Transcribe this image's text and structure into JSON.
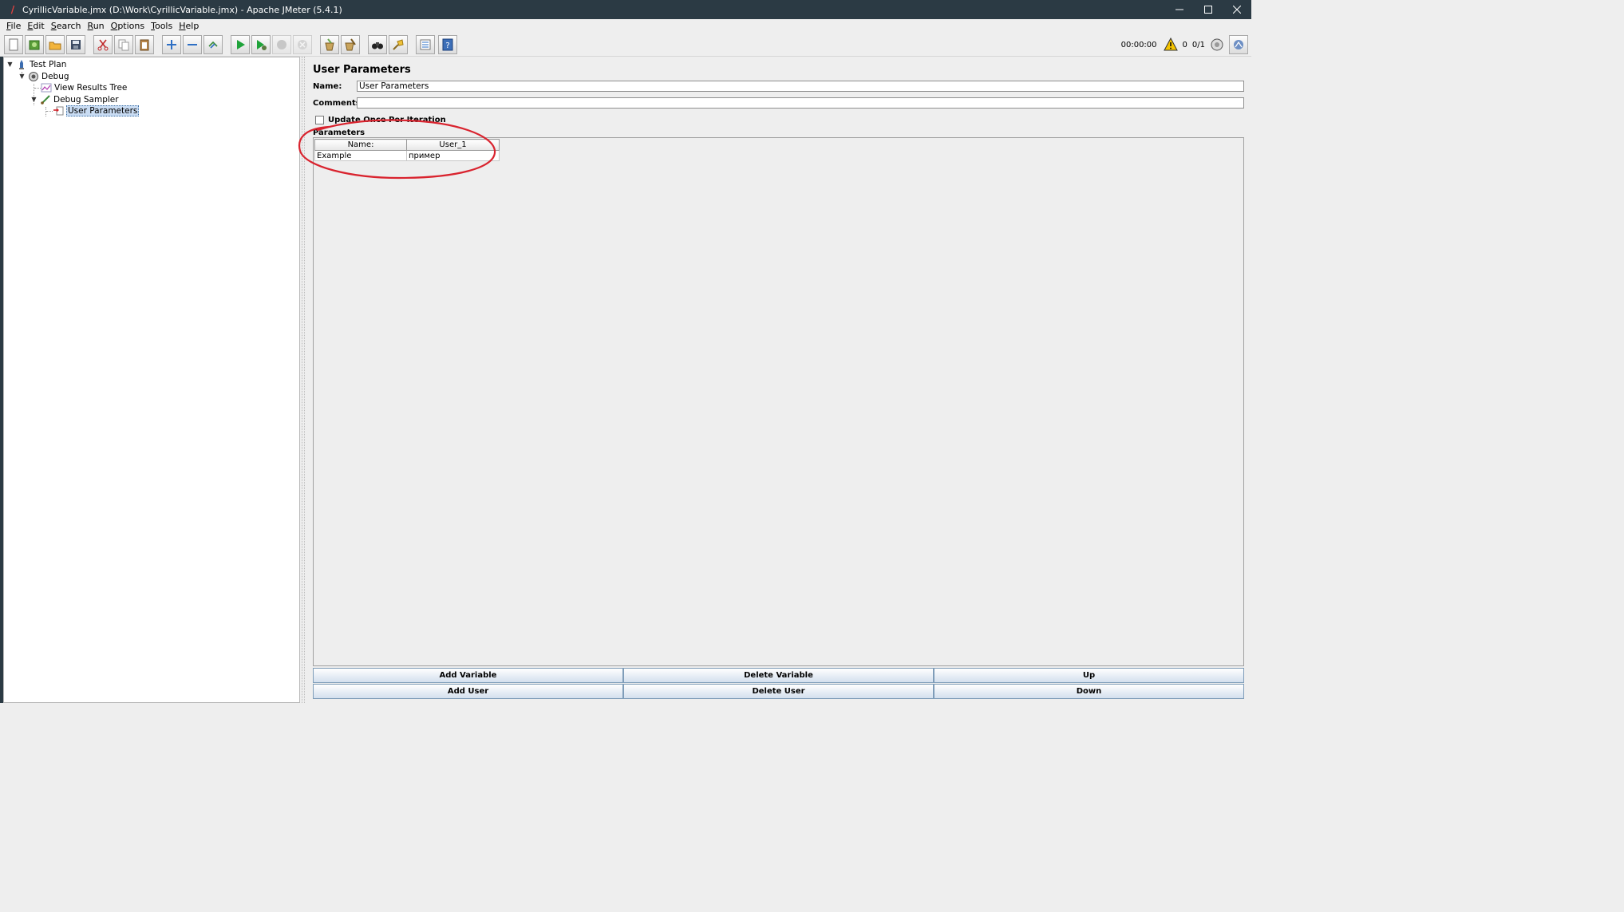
{
  "window": {
    "title": "CyrillicVariable.jmx (D:\\Work\\CyrillicVariable.jmx) - Apache JMeter (5.4.1)",
    "controls": [
      "minimize-icon",
      "maximize-icon",
      "close-icon"
    ]
  },
  "menu": {
    "items": [
      {
        "mn": "F",
        "rest": "ile"
      },
      {
        "mn": "E",
        "rest": "dit"
      },
      {
        "mn": "S",
        "rest": "earch"
      },
      {
        "mn": "R",
        "rest": "un"
      },
      {
        "mn": "O",
        "rest": "ptions"
      },
      {
        "mn": "T",
        "rest": "ools"
      },
      {
        "mn": "H",
        "rest": "elp"
      }
    ]
  },
  "toolbar": {
    "buttons": [
      "new-icon",
      "templates-icon",
      "open-icon",
      "save-icon",
      "cut-icon",
      "copy-icon",
      "paste-icon",
      "expand-icon",
      "collapse-icon",
      "toggle-icon",
      "start-icon",
      "start-no-pause-icon",
      "stop-icon",
      "shutdown-icon",
      "clear-icon",
      "clear-all-icon",
      "search-icon",
      "reset-search-icon",
      "function-helper-icon",
      "help-icon"
    ],
    "elapsed_time": "00:00:00",
    "warning_count": "0",
    "threads": "0/1"
  },
  "tree": {
    "nodes": [
      {
        "label": "Test Plan",
        "icon": "test-plan-icon",
        "expanded": true
      },
      {
        "label": "Debug",
        "icon": "thread-group-icon",
        "expanded": true
      },
      {
        "label": "View Results Tree",
        "icon": "listener-icon"
      },
      {
        "label": "Debug Sampler",
        "icon": "sampler-icon",
        "expanded": true
      },
      {
        "label": "User Parameters",
        "icon": "preprocessor-icon",
        "selected": true
      }
    ]
  },
  "editor": {
    "title": "User Parameters",
    "name_label": "Name:",
    "name_value": "User Parameters",
    "comments_label": "Comments:",
    "comments_value": "",
    "update_once_label": "Update Once Per Iteration",
    "update_once_checked": false,
    "parameters_label": "Parameters",
    "table": {
      "columns": [
        "Name:",
        "User_1"
      ],
      "rows": [
        [
          "Example",
          "пример"
        ]
      ]
    },
    "buttons": {
      "add_variable": "Add Variable",
      "delete_variable": "Delete Variable",
      "up": "Up",
      "add_user": "Add User",
      "delete_user": "Delete User",
      "down": "Down"
    }
  },
  "annotation": {
    "color": "#d9232e",
    "shape": "ellipse"
  }
}
